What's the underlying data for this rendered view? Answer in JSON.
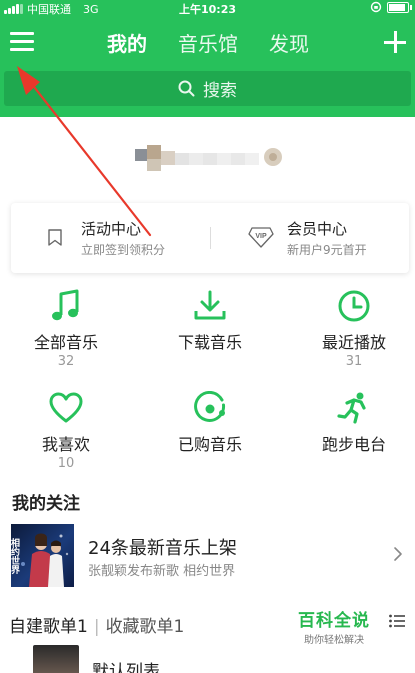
{
  "status_bar": {
    "carrier": "中国联通",
    "network": "3G",
    "time": "上午10:23"
  },
  "nav": {
    "tabs": [
      {
        "label": "我的",
        "active": true
      },
      {
        "label": "音乐馆",
        "active": false
      },
      {
        "label": "发现",
        "active": false
      }
    ]
  },
  "search": {
    "placeholder": "搜索"
  },
  "activity_card": {
    "left": {
      "title": "活动中心",
      "subtitle": "立即签到领积分"
    },
    "right": {
      "title": "会员中心",
      "subtitle": "新用户9元首开",
      "badge": "VIP"
    }
  },
  "grid": [
    {
      "label": "全部音乐",
      "count": "32",
      "icon": "music-note-icon"
    },
    {
      "label": "下载音乐",
      "count": "",
      "icon": "download-icon"
    },
    {
      "label": "最近播放",
      "count": "31",
      "icon": "clock-icon"
    },
    {
      "label": "我喜欢",
      "count": "10",
      "icon": "heart-icon"
    },
    {
      "label": "已购音乐",
      "count": "",
      "icon": "purchased-disc-icon"
    },
    {
      "label": "跑步电台",
      "count": "",
      "icon": "running-icon"
    }
  ],
  "follow_section": {
    "title": "我的关注",
    "item": {
      "title": "24条最新音乐上架",
      "subtitle": "张靓颖发布新歌 相约世界",
      "cover_text": "相约世界"
    }
  },
  "playlist_tabs": {
    "created": "自建歌单1",
    "separator": "|",
    "favorites": "收藏歌单1"
  },
  "watermark": {
    "main": "百科全说",
    "sub": "助你轻松解决"
  },
  "playlist": {
    "first_title": "默认列表"
  },
  "colors": {
    "brand_green": "#27c15b",
    "search_bg": "#1fa94f",
    "annotation_arrow": "#e8392b"
  }
}
